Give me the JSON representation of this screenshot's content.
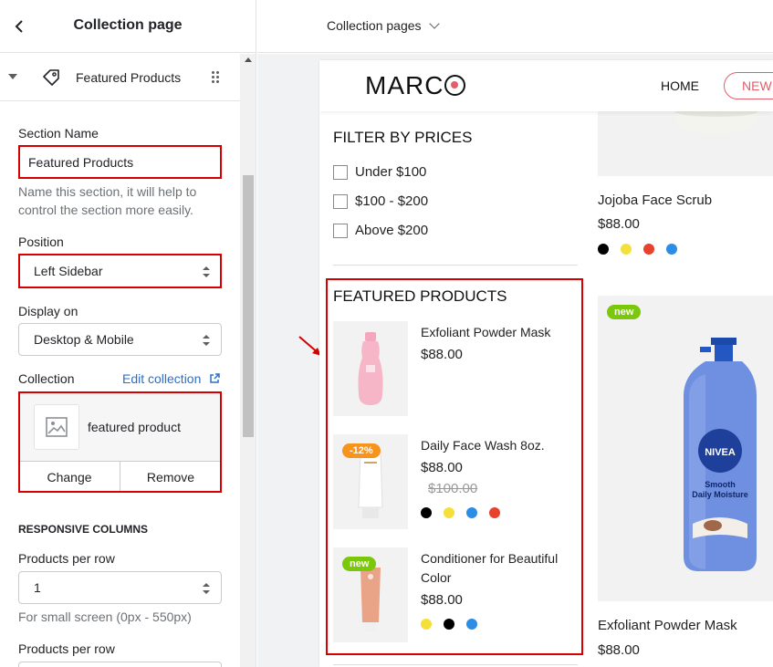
{
  "editor": {
    "title": "Collection page",
    "section_label": "Featured Products",
    "section_name_label": "Section Name",
    "section_name_value": "Featured Products",
    "section_name_help": "Name this section, it will help to control the section more easily.",
    "position_label": "Position",
    "position_value": "Left Sidebar",
    "display_label": "Display on",
    "display_value": "Desktop & Mobile",
    "collection_label": "Collection",
    "edit_collection": "Edit collection",
    "collection_name": "featured product",
    "change_btn": "Change",
    "remove_btn": "Remove",
    "responsive_heading": "RESPONSIVE COLUMNS",
    "per_row_label": "Products per row",
    "per_row_value": "1",
    "per_row_help": "For small screen (0px - 550px)",
    "per_row_label_2": "Products per row"
  },
  "topbar": {
    "page_selector": "Collection pages"
  },
  "store": {
    "logo_text_1": "MARC",
    "nav_home": "HOME",
    "nav_new": "NEW",
    "filter_title": "FILTER BY PRICES",
    "filters": [
      "Under $100",
      "$100 - $200",
      "Above $200"
    ],
    "featured_title": "FEATURED PRODUCTS",
    "featured": [
      {
        "name": "Exfoliant Powder Mask",
        "price": "$88.00"
      },
      {
        "name": "Daily Face Wash 8oz.",
        "price": "$88.00",
        "old_price": "$100.00",
        "badge": "-12%"
      },
      {
        "name": "Conditioner for Beautiful Color",
        "price": "$88.00",
        "badge": "new"
      }
    ],
    "grid": [
      {
        "name": "Jojoba Face Scrub",
        "price": "$88.00"
      },
      {
        "name": "Exfoliant Powder Mask",
        "price": "$88.00",
        "badge": "new"
      }
    ],
    "bottle_brand": "NIVEA",
    "bottle_line1": "Smooth",
    "bottle_line2": "Daily Moisture"
  },
  "colors": {
    "accent_red": "#d60000",
    "badge_orange": "#f7941d",
    "badge_green": "#7ac70c",
    "link_blue": "#2c6ecb",
    "nav_pink": "#e35d6a",
    "swatch_black": "#000000",
    "swatch_yellow": "#f5e03b",
    "swatch_red": "#e8412c",
    "swatch_blue": "#2b8de6"
  },
  "icons": [
    "back-arrow-icon",
    "caret-down-icon",
    "tag-icon",
    "drag-handle-icon",
    "select-arrows-icon",
    "external-link-icon",
    "image-placeholder-icon",
    "chevron-down-icon",
    "red-arrow-icon"
  ]
}
